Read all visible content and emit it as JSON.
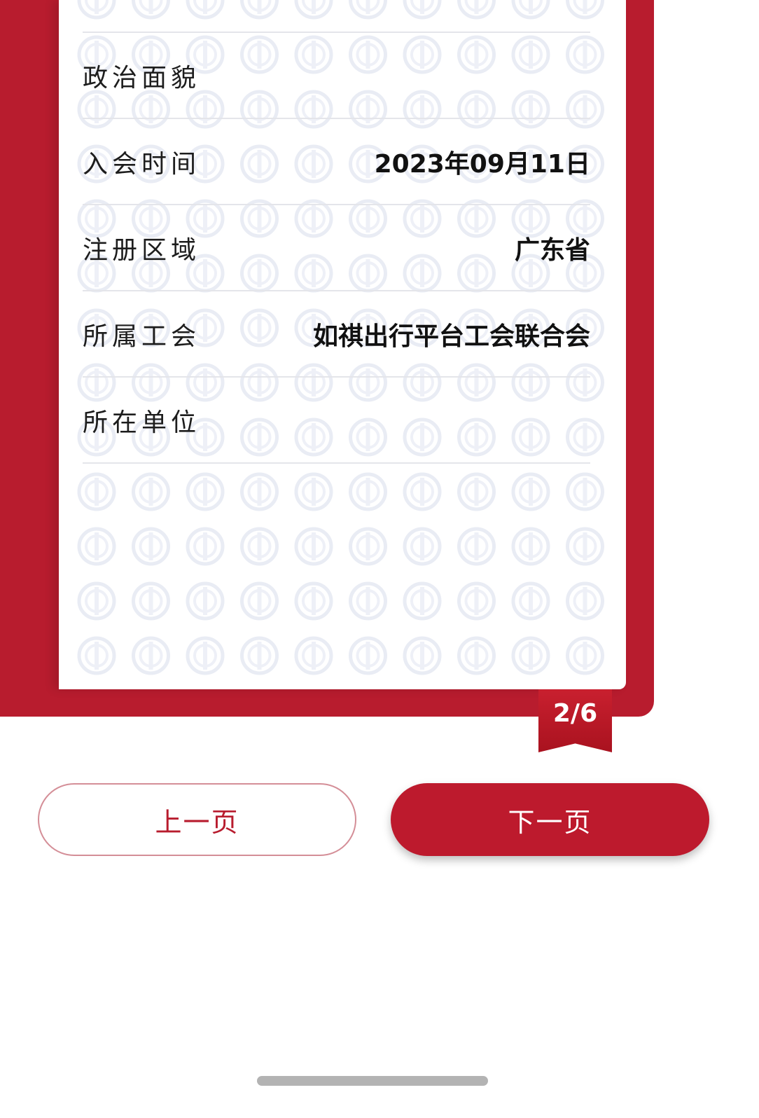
{
  "card": {
    "rows": [
      {
        "label": "政治面貌",
        "value": ""
      },
      {
        "label": "入会时间",
        "value": "2023年09月11日"
      },
      {
        "label": "注册区域",
        "value": "广东省"
      },
      {
        "label": "所属工会",
        "value": "如祺出行平台工会联合会"
      },
      {
        "label": "所在单位",
        "value": ""
      }
    ]
  },
  "page_indicator": "2/6",
  "buttons": {
    "prev": "上一页",
    "next": "下一页"
  },
  "colors": {
    "accent": "#b81c2e",
    "watermark": "#e9ecf4"
  },
  "icons": {
    "watermark": "union-emblem-icon"
  }
}
